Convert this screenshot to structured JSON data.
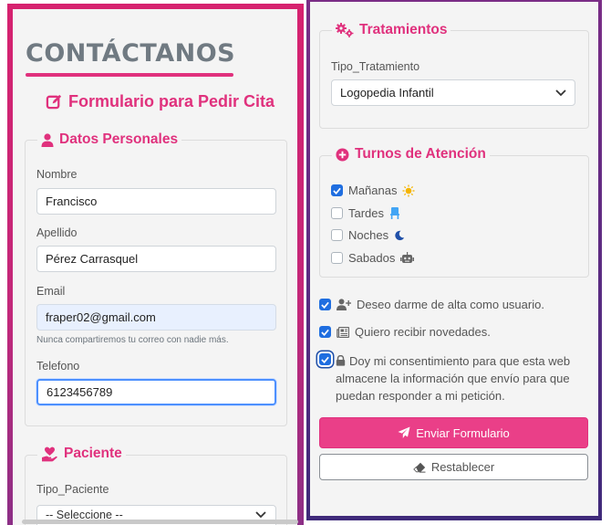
{
  "page": {
    "title": "CONTÁCTANOS"
  },
  "form": {
    "heading": "Formulario para Pedir Cita"
  },
  "personal": {
    "legend": "Datos Personales",
    "nombre_label": "Nombre",
    "nombre_value": "Francisco",
    "apellido_label": "Apellido",
    "apellido_value": "Pérez Carrasquel",
    "email_label": "Email",
    "email_value": "fraper02@gmail.com",
    "email_help": "Nunca compartiremos tu correo con nadie más.",
    "telefono_label": "Telefono",
    "telefono_value": "6123456789"
  },
  "paciente": {
    "legend": "Paciente",
    "tipo_label": "Tipo_Paciente",
    "tipo_selected": "-- Seleccione --"
  },
  "tratamientos": {
    "legend": "Tratamientos",
    "tipo_label": "Tipo_Tratamiento",
    "tipo_selected": "Logopedia Infantil"
  },
  "turnos": {
    "legend": "Turnos de Atención",
    "items": [
      {
        "label": "Mañanas",
        "checked": true,
        "icon": "sun-icon"
      },
      {
        "label": "Tardes",
        "checked": false,
        "icon": "chair-icon"
      },
      {
        "label": "Noches",
        "checked": false,
        "icon": "moon-icon"
      },
      {
        "label": "Sabados",
        "checked": false,
        "icon": "robot-icon"
      }
    ]
  },
  "options": {
    "alta": "Deseo darme de alta como usuario.",
    "novedades": "Quiero recibir novedades.",
    "consentimiento": "Doy mi consentimiento para que esta web almacene la información que envío para que puedan responder a mi petición."
  },
  "buttons": {
    "enviar": "Enviar Formulario",
    "restablecer": "Restablecer"
  },
  "colors": {
    "accent": "#e0317d",
    "button": "#ea3f88",
    "checkbox": "#1f6ee0",
    "title": "#707a82"
  }
}
